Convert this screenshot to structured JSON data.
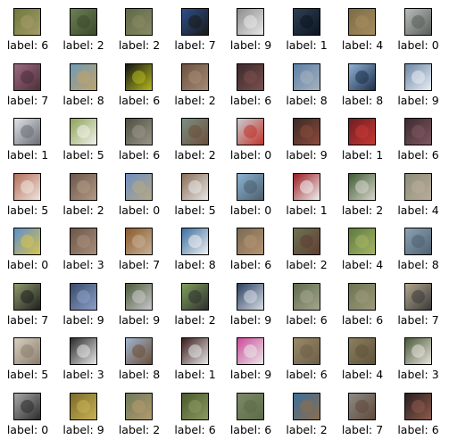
{
  "grid": {
    "rows": 8,
    "cols": 8,
    "items": [
      {
        "label": "label: 6",
        "palette": [
          "#6d7a3a",
          "#a69b6a"
        ]
      },
      {
        "label": "label: 2",
        "palette": [
          "#6b7f52",
          "#3d4a2c"
        ]
      },
      {
        "label": "label: 2",
        "palette": [
          "#5c6a47",
          "#8a8a63"
        ]
      },
      {
        "label": "label: 7",
        "palette": [
          "#2d4f88",
          "#1a1a1a"
        ]
      },
      {
        "label": "label: 9",
        "palette": [
          "#8d8d8d",
          "#e8e8e8"
        ]
      },
      {
        "label": "label: 1",
        "palette": [
          "#2f3f56",
          "#0d1520"
        ]
      },
      {
        "label": "label: 4",
        "palette": [
          "#7a6c44",
          "#a88c5e"
        ]
      },
      {
        "label": "label: 0",
        "palette": [
          "#b7bdb9",
          "#5a5f5c"
        ]
      },
      {
        "label": "label: 7",
        "palette": [
          "#9b6a7f",
          "#4d2e3a"
        ]
      },
      {
        "label": "label: 8",
        "palette": [
          "#6e9bb6",
          "#c1a36a"
        ]
      },
      {
        "label": "label: 6",
        "palette": [
          "#151515",
          "#b3b81c"
        ]
      },
      {
        "label": "label: 2",
        "palette": [
          "#6c5242",
          "#a58b73"
        ]
      },
      {
        "label": "label: 6",
        "palette": [
          "#3c2a2d",
          "#7b4f4d"
        ]
      },
      {
        "label": "label: 8",
        "palette": [
          "#5b7fa8",
          "#a6b2be"
        ]
      },
      {
        "label": "label: 8",
        "palette": [
          "#8fb1d6",
          "#1e2f4a"
        ]
      },
      {
        "label": "label: 9",
        "palette": [
          "#6e88a8",
          "#e8edf2"
        ]
      },
      {
        "label": "label: 1",
        "palette": [
          "#dfe2e6",
          "#6a6e75"
        ]
      },
      {
        "label": "label: 5",
        "palette": [
          "#8ea35a",
          "#f1f1ea"
        ]
      },
      {
        "label": "label: 6",
        "palette": [
          "#4e5043",
          "#9a9686"
        ]
      },
      {
        "label": "label: 2",
        "palette": [
          "#7b8f82",
          "#6c4f3a"
        ]
      },
      {
        "label": "label: 0",
        "palette": [
          "#c8ccd2",
          "#c1352b"
        ]
      },
      {
        "label": "label: 9",
        "palette": [
          "#3b2a25",
          "#8b4b3c"
        ]
      },
      {
        "label": "label: 1",
        "palette": [
          "#6e1e22",
          "#c73834"
        ]
      },
      {
        "label": "label: 6",
        "palette": [
          "#3e2a31",
          "#7e5760"
        ]
      },
      {
        "label": "label: 5",
        "palette": [
          "#b3715c",
          "#f0e4dc"
        ]
      },
      {
        "label": "label: 2",
        "palette": [
          "#6b574c",
          "#b39a84"
        ]
      },
      {
        "label": "label: 0",
        "palette": [
          "#6d8fc3",
          "#b7a985"
        ]
      },
      {
        "label": "label: 5",
        "palette": [
          "#8a6f5a",
          "#e8e6e4"
        ]
      },
      {
        "label": "label: 0",
        "palette": [
          "#8bb3d4",
          "#4d5e6e"
        ]
      },
      {
        "label": "label: 1",
        "palette": [
          "#9a1c22",
          "#f0f0f0"
        ]
      },
      {
        "label": "label: 2",
        "palette": [
          "#3f5a33",
          "#d7d7cc"
        ]
      },
      {
        "label": "label: 4",
        "palette": [
          "#8e8e78",
          "#b9ad9a"
        ]
      },
      {
        "label": "label: 0",
        "palette": [
          "#5d8fcf",
          "#d9c24c"
        ]
      },
      {
        "label": "label: 3",
        "palette": [
          "#6c5649",
          "#a88e7b"
        ]
      },
      {
        "label": "label: 7",
        "palette": [
          "#8a5a2c",
          "#c7b196"
        ]
      },
      {
        "label": "label: 8",
        "palette": [
          "#3c6fa1",
          "#f0f0f0"
        ]
      },
      {
        "label": "label: 6",
        "palette": [
          "#7a6a54",
          "#b59470"
        ]
      },
      {
        "label": "label: 2",
        "palette": [
          "#6d7453",
          "#5f3e33"
        ]
      },
      {
        "label": "label: 4",
        "palette": [
          "#5d7a3e",
          "#a6b566"
        ]
      },
      {
        "label": "label: 8",
        "palette": [
          "#8ba3b5",
          "#4f6171"
        ]
      },
      {
        "label": "label: 7",
        "palette": [
          "#8e9b6c",
          "#1f1f1f"
        ]
      },
      {
        "label": "label: 9",
        "palette": [
          "#3a4a6a",
          "#8ba0c8"
        ]
      },
      {
        "label": "label: 9",
        "palette": [
          "#4b5a3a",
          "#c9c9c9"
        ]
      },
      {
        "label": "label: 2",
        "palette": [
          "#7ea05a",
          "#2f2f2f"
        ]
      },
      {
        "label": "label: 9",
        "palette": [
          "#2a3f5f",
          "#d7dde6"
        ]
      },
      {
        "label": "label: 6",
        "palette": [
          "#5f6a4d",
          "#a3a58c"
        ]
      },
      {
        "label": "label: 6",
        "palette": [
          "#6e7352",
          "#9c9a78"
        ]
      },
      {
        "label": "label: 7",
        "palette": [
          "#b3a58c",
          "#3a3a3a"
        ]
      },
      {
        "label": "label: 5",
        "palette": [
          "#d8cfc0",
          "#8a7d6c"
        ]
      },
      {
        "label": "label: 3",
        "palette": [
          "#2b2b2b",
          "#e6e6e6"
        ]
      },
      {
        "label": "label: 8",
        "palette": [
          "#9fb6cf",
          "#6d4f3a"
        ]
      },
      {
        "label": "label: 1",
        "palette": [
          "#3a1c1c",
          "#e6e6e6"
        ]
      },
      {
        "label": "label: 9",
        "palette": [
          "#d04a9a",
          "#e8e8e8"
        ]
      },
      {
        "label": "label: 6",
        "palette": [
          "#9a8a6a",
          "#6d5f48"
        ]
      },
      {
        "label": "label: 4",
        "palette": [
          "#8c7f5e",
          "#5f533b"
        ]
      },
      {
        "label": "label: 3",
        "palette": [
          "#4a5a3a",
          "#e6e2da"
        ]
      },
      {
        "label": "label: 0",
        "palette": [
          "#a8a8a8",
          "#2c2c2c"
        ]
      },
      {
        "label": "label: 9",
        "palette": [
          "#7a6b2a",
          "#c9b155"
        ]
      },
      {
        "label": "label: 2",
        "palette": [
          "#6d7a5a",
          "#b39a6e"
        ]
      },
      {
        "label": "label: 6",
        "palette": [
          "#4a5a2e",
          "#8b9960"
        ]
      },
      {
        "label": "label: 6",
        "palette": [
          "#7a8a6a",
          "#5f6b47"
        ]
      },
      {
        "label": "label: 2",
        "palette": [
          "#3a6f9a",
          "#8c6e4e"
        ]
      },
      {
        "label": "label: 7",
        "palette": [
          "#8e8a86",
          "#5f4a3a"
        ]
      },
      {
        "label": "label: 6",
        "palette": [
          "#2a1f1f",
          "#8c5a4c"
        ]
      }
    ]
  }
}
